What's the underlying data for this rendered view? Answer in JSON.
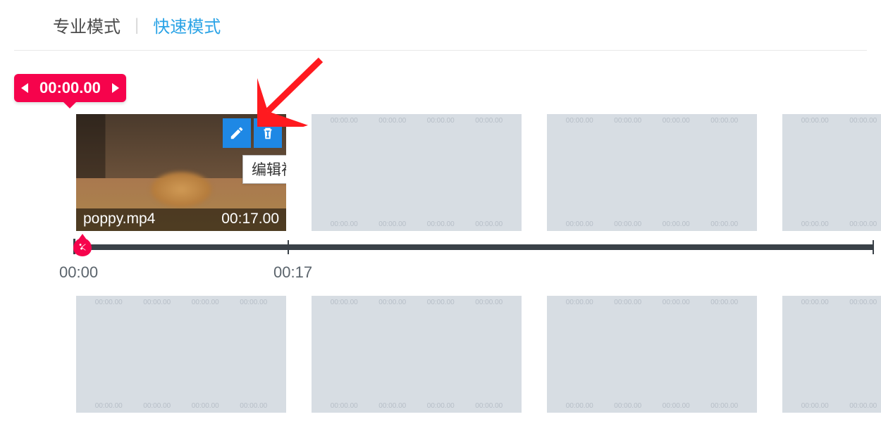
{
  "modes": {
    "pro": "专业模式",
    "quick": "快速模式",
    "active": "quick"
  },
  "playhead": {
    "time": "00:00.00"
  },
  "clip": {
    "filename": "poppy.mp4",
    "duration": "00:17.00",
    "tooltip": "编辑视频"
  },
  "timeline": {
    "labels": [
      "00:00",
      "00:17"
    ]
  },
  "placeholder_tick": "00:00.00",
  "colors": {
    "accent_pink": "#f6034c",
    "accent_blue": "#1e88e5",
    "link_blue": "#2aa3e6"
  }
}
